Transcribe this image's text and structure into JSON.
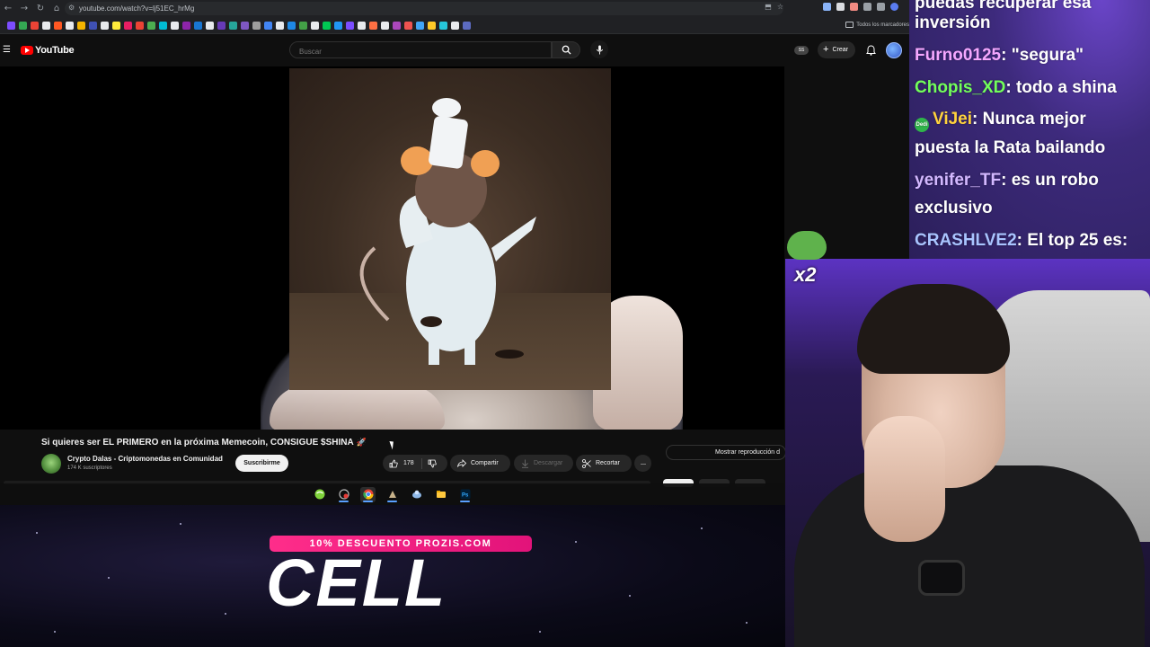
{
  "browser": {
    "url": "youtube.com/watch?v=lj51EC_hrMg",
    "bookmarks_folder": "Todos los marcadores"
  },
  "youtube": {
    "wordmark": "YouTube",
    "search_placeholder": "Buscar",
    "account_badge": "SS",
    "create_label": "Crear"
  },
  "video": {
    "title": "Si quieres ser EL PRIMERO en la próxima Memecoin, CONSIGUE $SHINA",
    "title_emoji": "🚀",
    "channel_name": "Crypto Dalas - Criptomonedas en Comunidad",
    "subscribers": "174 K suscriptores",
    "subscribe_label": "Suscribirme",
    "likes": "178",
    "share_label": "Compartir",
    "download_label": "Descargar",
    "clip_label": "Recortar",
    "more_label": "···",
    "chat_replay_label": "Mostrar reproducción d"
  },
  "overlay": {
    "promo": "10% DESCUENTO PROZIS.COM",
    "brand": "CELL",
    "emote_label": "x2"
  },
  "chat": {
    "lines": [
      {
        "user": "",
        "message": "puedas recuperar esa",
        "color": "#ffffff"
      },
      {
        "user": "",
        "message": "inversión",
        "color": "#ffffff"
      },
      {
        "user": "Furno0125",
        "message": ": \"segura\"",
        "color": "#f4a7ff"
      },
      {
        "user": "Chopis_XD",
        "message": ": todo a shina",
        "color": "#72ff5a"
      },
      {
        "user": "ViJei",
        "message": ": Nunca mejor",
        "color": "#ffd23d",
        "badge": "Dedi"
      },
      {
        "user": "",
        "message": "puesta la Rata bailando",
        "color": "#ffffff"
      },
      {
        "user": "yenifer_TF",
        "message": ": es un robo",
        "color": "#d3b8ff"
      },
      {
        "user": "",
        "message": "exclusivo",
        "color": "#ffffff"
      },
      {
        "user": "CRASHLVE2",
        "message": ": El top 25 es:",
        "color": "#a9c4ff"
      }
    ]
  },
  "icons": {
    "back": "arrow-left-icon",
    "forward": "arrow-right-icon",
    "reload": "reload-icon",
    "home": "home-icon",
    "search": "search-icon",
    "mic": "microphone-icon",
    "bell": "bell-icon",
    "like": "thumbs-up-icon",
    "dislike": "thumbs-down-icon",
    "share": "share-arrow-icon",
    "download": "download-icon",
    "clip": "scissors-icon"
  },
  "colors": {
    "yt_red": "#ff0000",
    "promo_pink": "#ff2d8a",
    "chat_bg": "#3d2a7c"
  }
}
